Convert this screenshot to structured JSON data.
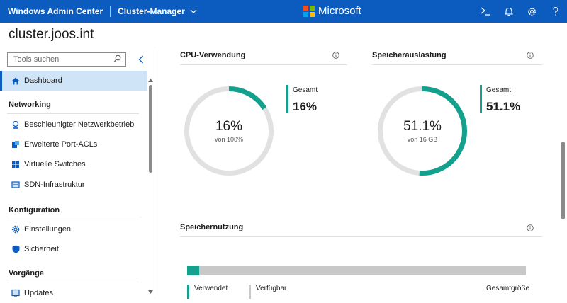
{
  "topbar": {
    "app_title": "Windows Admin Center",
    "context": "Cluster-Manager",
    "brand": "Microsoft"
  },
  "page": {
    "title": "cluster.joos.int"
  },
  "sidebar": {
    "search_placeholder": "Tools suchen",
    "items": {
      "dashboard": "Dashboard",
      "accel_network": "Beschleunigter Netzwerkbetrieb",
      "port_acls": "Erweiterte Port-ACLs",
      "virtual_switches": "Virtuelle Switches",
      "sdn": "SDN-Infrastruktur",
      "settings": "Einstellungen",
      "security": "Sicherheit",
      "updates": "Updates"
    },
    "sections": {
      "networking": "Networking",
      "configuration": "Konfiguration",
      "operations": "Vorgänge"
    }
  },
  "cpu": {
    "title": "CPU-Verwendung",
    "value_text": "16%",
    "sub_text": "von 100%",
    "legend_label": "Gesamt",
    "legend_value": "16%",
    "percent": 16
  },
  "memory": {
    "title": "Speicherauslastung",
    "value_text": "51.1%",
    "sub_text": "von 16 GB",
    "legend_label": "Gesamt",
    "legend_value": "51.1%",
    "percent": 51.1
  },
  "storage": {
    "title": "Speichernutzung",
    "used_label": "Verwendet",
    "available_label": "Verfügbar",
    "total_label": "Gesamtgröße",
    "used_fraction": 0.035
  },
  "colors": {
    "accent": "#13a08c",
    "track": "#e1e1e1",
    "topbar": "#0b5cbe",
    "available": "#c8c8c8"
  }
}
